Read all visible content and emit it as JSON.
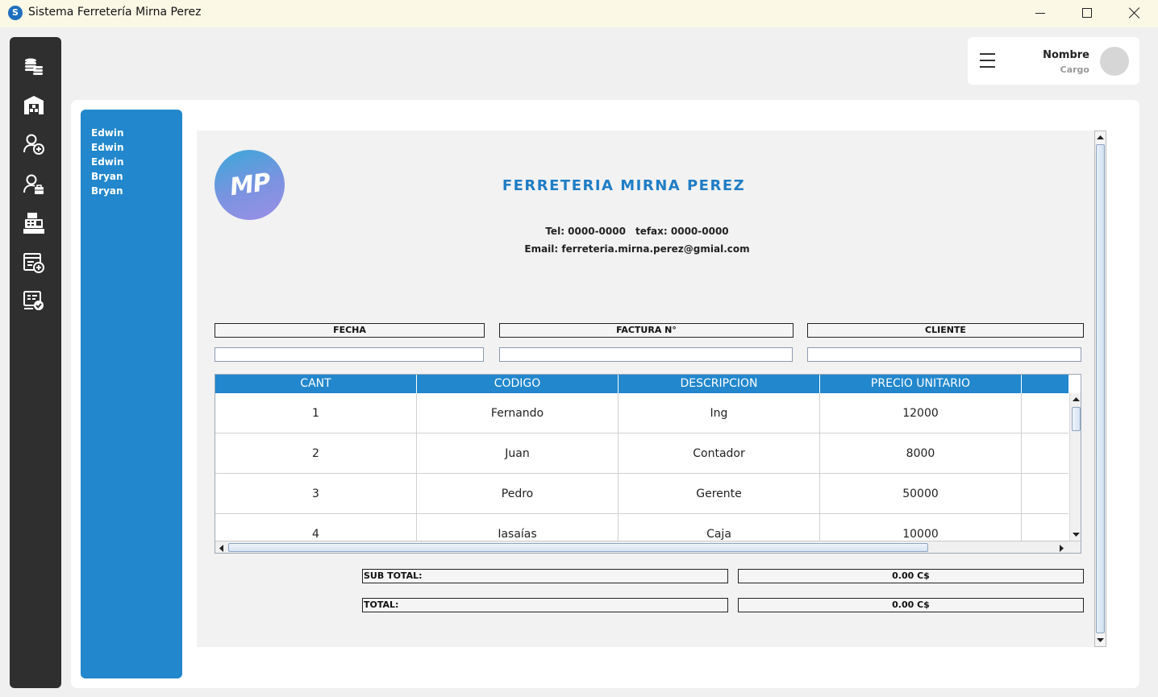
{
  "window": {
    "title": "Sistema Ferretería Mirna Perez",
    "app_icon_letter": "S"
  },
  "rail": {
    "items": [
      {
        "icon": "coins-stack-icon"
      },
      {
        "icon": "warehouse-icon"
      },
      {
        "icon": "add-user-icon"
      },
      {
        "icon": "user-briefcase-icon"
      },
      {
        "icon": "cash-register-icon"
      },
      {
        "icon": "add-invoice-icon"
      },
      {
        "icon": "approved-invoice-icon"
      }
    ]
  },
  "profile": {
    "name": "Nombre",
    "role": "Cargo"
  },
  "blue_panel": {
    "names": [
      "Edwin",
      "Edwin",
      "Edwin",
      "Bryan",
      "Bryan"
    ]
  },
  "invoice": {
    "logo_text": "MP",
    "title": "FERRETERIA MIRNA PEREZ",
    "tel": "Tel: 0000-0000",
    "fax": "tefax: 0000-0000",
    "email": "Email: ferreteria.mirna.perez@gmial.com",
    "labels": {
      "fecha": "FECHA",
      "factura": "FACTURA N°",
      "cliente": "CLIENTE"
    },
    "inputs": {
      "fecha": "",
      "factura": "",
      "cliente": ""
    },
    "table": {
      "columns": [
        "CANT",
        "CODIGO",
        "DESCRIPCION",
        "PRECIO UNITARIO",
        ""
      ],
      "rows": [
        [
          "1",
          "Fernando",
          "Ing",
          "12000",
          ""
        ],
        [
          "2",
          "Juan",
          "Contador",
          "8000",
          ""
        ],
        [
          "3",
          "Pedro",
          "Gerente",
          "50000",
          ""
        ],
        [
          "4",
          "Iasaías",
          "Caja",
          "10000",
          ""
        ]
      ]
    },
    "subtotal_label": "SUB TOTAL:",
    "subtotal_value": "0.00 C$",
    "total_label": "TOTAL:",
    "total_value": "0.00 C$"
  },
  "colors": {
    "accent": "#2287cc",
    "rail": "#2f2f2f",
    "titlebar": "#fbf8e6"
  }
}
